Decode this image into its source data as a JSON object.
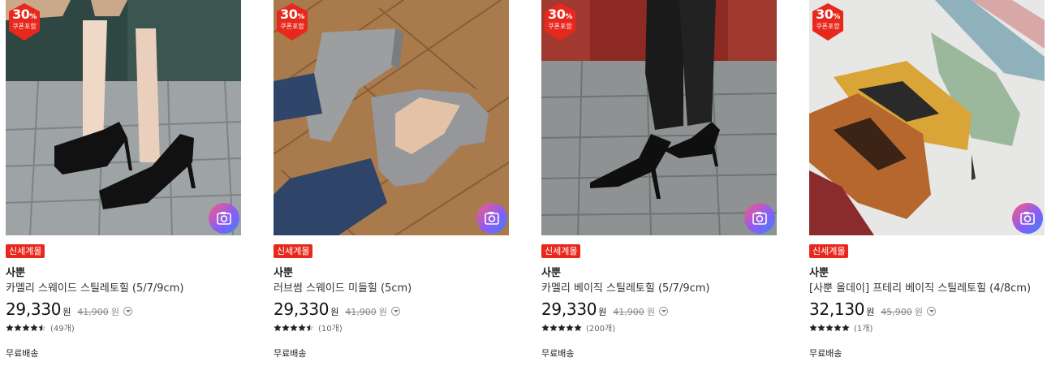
{
  "products": [
    {
      "coupon_pct": "30",
      "coupon_pct_sign": "%",
      "coupon_label": "쿠폰포함",
      "badge": "신세계몰",
      "brand": "사뿐",
      "name": "카멜리 스웨이드 스틸레토힐 (5/7/9cm)",
      "price": "29,330",
      "currency": "원",
      "original_price": "41,900",
      "original_currency": "원",
      "rating": 4.5,
      "review_count": "(49개)",
      "shipping": "무료배송",
      "image_icon": "black-suede-stiletto-photo",
      "review_photo_icon": "camera-icon"
    },
    {
      "coupon_pct": "30",
      "coupon_pct_sign": "%",
      "coupon_label": "쿠폰포함",
      "badge": "신세계몰",
      "brand": "사뿐",
      "name": "러브썸 스웨이드 미들힐 (5cm)",
      "price": "29,330",
      "currency": "원",
      "original_price": "41,900",
      "original_currency": "원",
      "rating": 4.5,
      "review_count": "(10개)",
      "shipping": "무료배송",
      "image_icon": "grey-suede-middle-heel-photo",
      "review_photo_icon": "camera-icon"
    },
    {
      "coupon_pct": "30",
      "coupon_pct_sign": "%",
      "coupon_label": "쿠폰포함",
      "badge": "신세계몰",
      "brand": "사뿐",
      "name": "카멜리 베이직 스틸레토힐 (5/7/9cm)",
      "price": "29,330",
      "currency": "원",
      "original_price": "41,900",
      "original_currency": "원",
      "rating": 5,
      "review_count": "(200개)",
      "shipping": "무료배송",
      "image_icon": "black-leather-stiletto-photo",
      "review_photo_icon": "camera-icon"
    },
    {
      "coupon_pct": "30",
      "coupon_pct_sign": "%",
      "coupon_label": "쿠폰포함",
      "badge": "신세계몰",
      "brand": "사뿐",
      "name": "[사뿐 올데이] 프테리 베이직 스틸레토힐 (4/8cm)",
      "price": "32,130",
      "currency": "원",
      "original_price": "45,900",
      "original_currency": "원",
      "rating": 5,
      "review_count": "(1개)",
      "shipping": "무료배송",
      "image_icon": "colorful-pumps-photo",
      "review_photo_icon": "camera-icon"
    }
  ],
  "colors": {
    "coupon_red": "#e8281d",
    "badge_red": "#e8281d",
    "star": "#222222"
  }
}
